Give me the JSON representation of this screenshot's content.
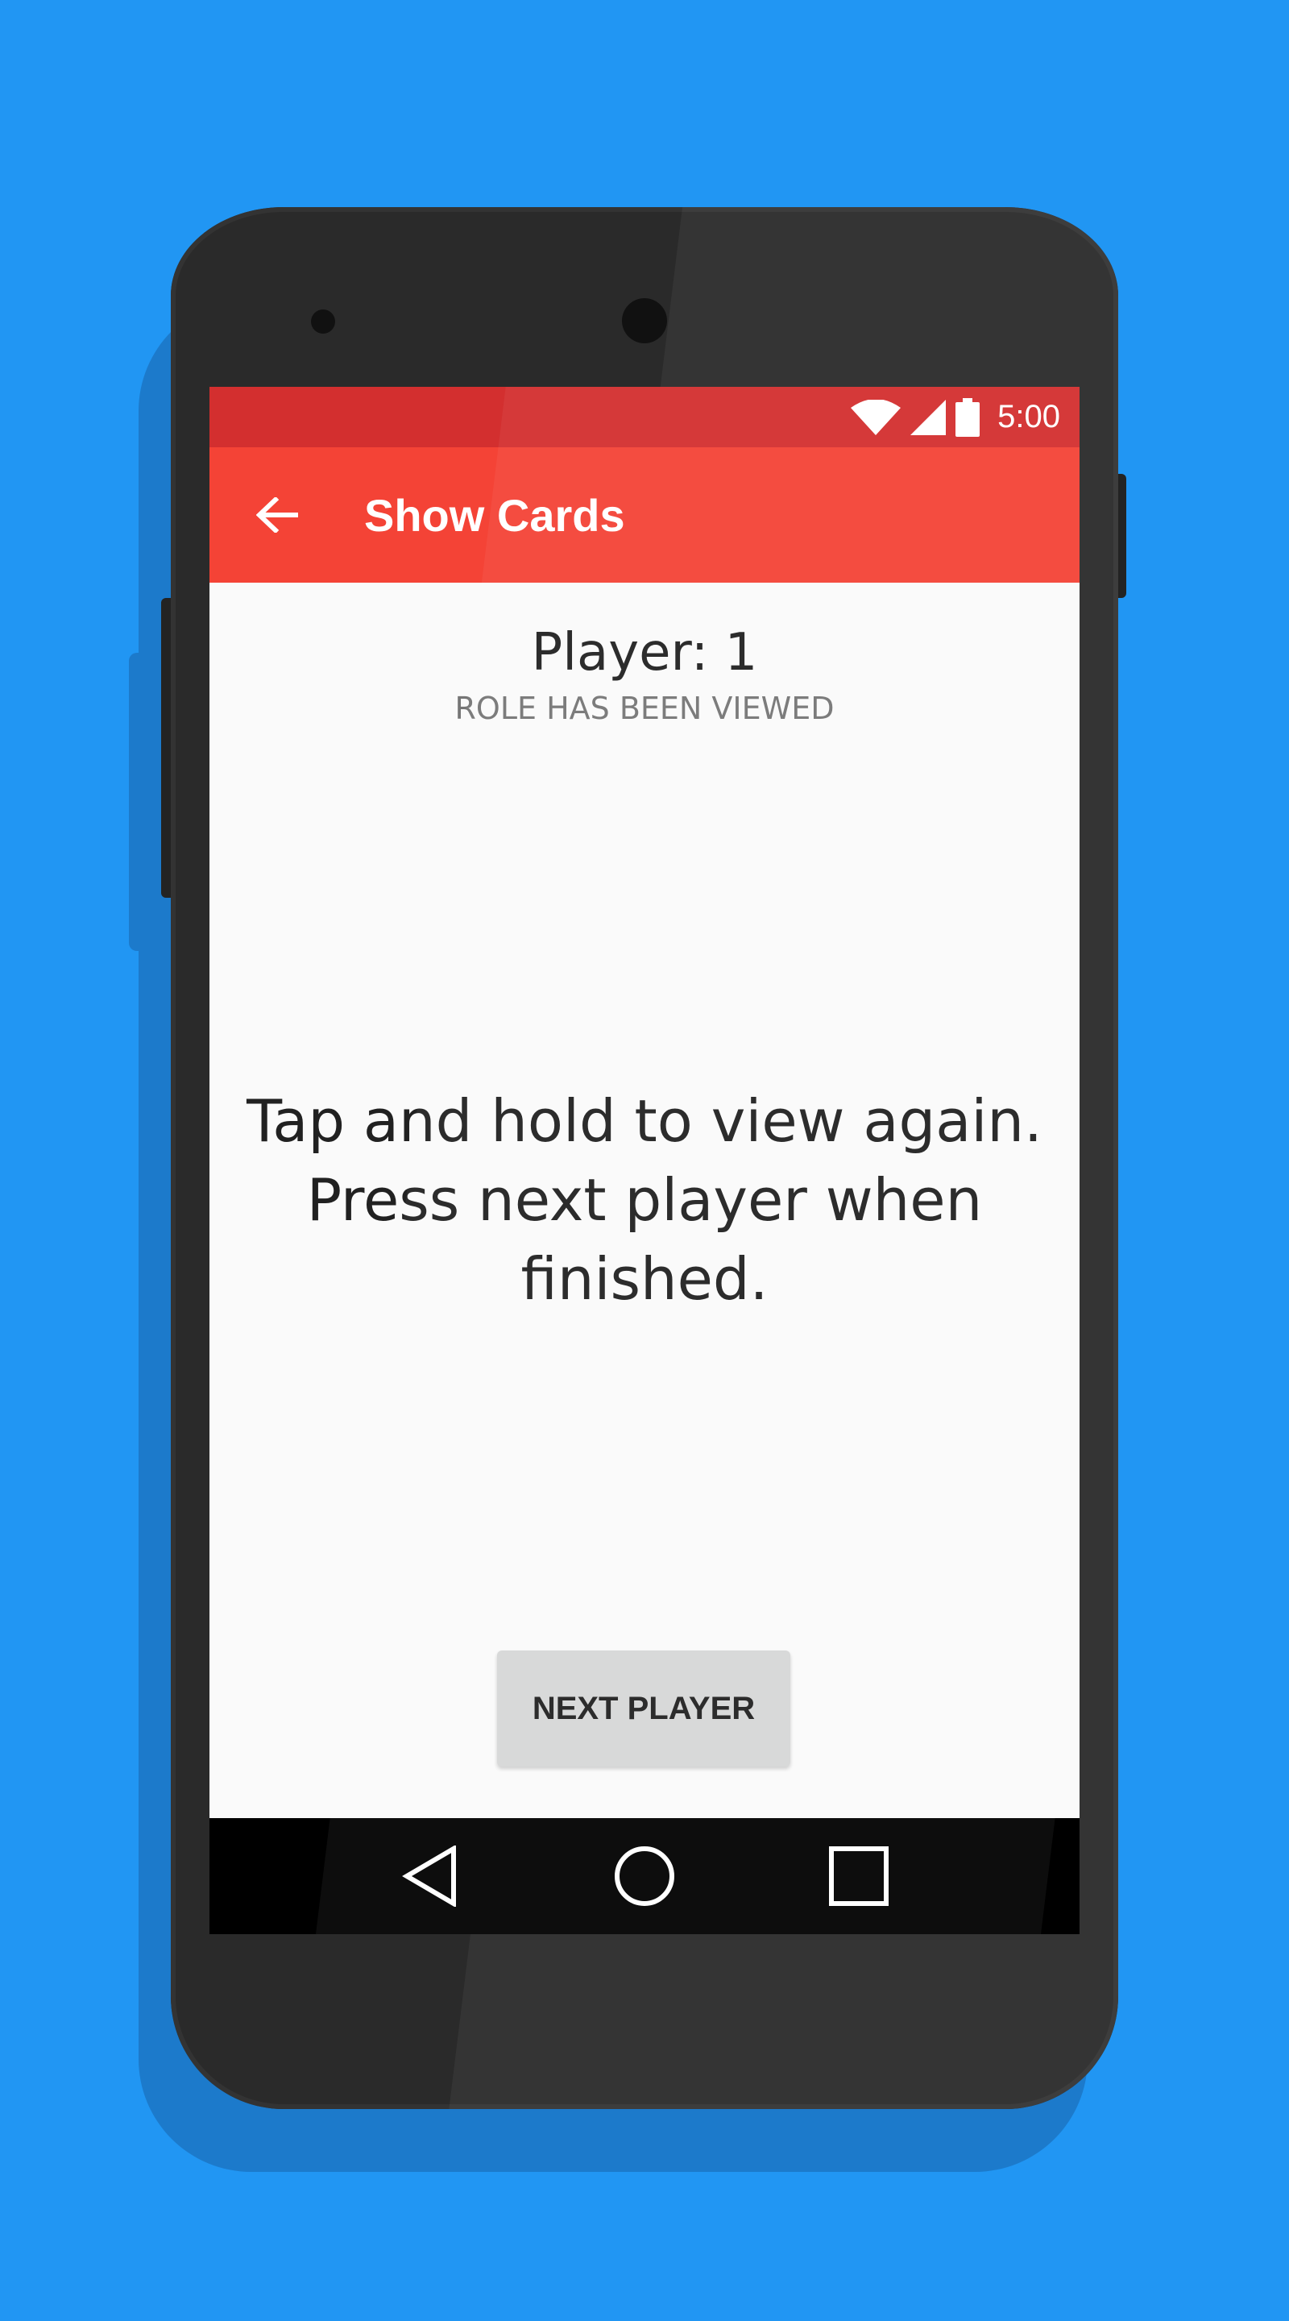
{
  "status_bar": {
    "time": "5:00",
    "icons": [
      "wifi-icon",
      "signal-icon",
      "battery-icon"
    ]
  },
  "toolbar": {
    "back_icon": "arrow-left-icon",
    "title": "Show Cards"
  },
  "content": {
    "player_label": "Player: 1",
    "role_status": "ROLE HAS BEEN VIEWED",
    "instruction": "Tap and hold to view again. Press next player when finished."
  },
  "actions": {
    "next_player_label": "NEXT PLAYER"
  },
  "nav_bar": {
    "icons": [
      "back-triangle-icon",
      "home-circle-icon",
      "recents-square-icon"
    ]
  },
  "colors": {
    "background": "#2196F3",
    "status_bar": "#D32F2F",
    "toolbar": "#F44336",
    "screen": "#FAFAFA",
    "button": "#D6D7D7",
    "nav_bar": "#000000"
  }
}
